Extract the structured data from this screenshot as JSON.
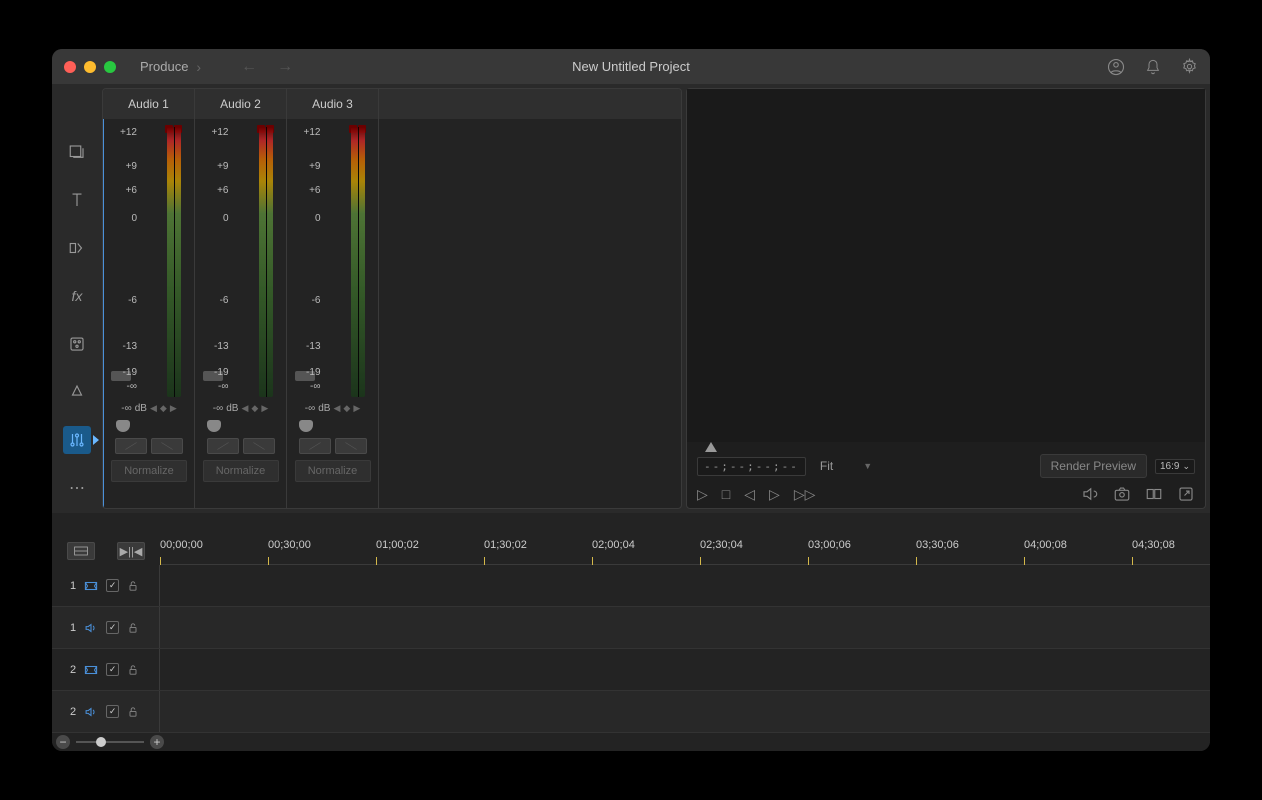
{
  "header": {
    "app": "Produce",
    "title": "New Untitled Project"
  },
  "mixer": {
    "channels": [
      {
        "name": "Audio 1",
        "db": "dB",
        "ninf_l": "-∞",
        "ninf_r": "-∞",
        "normalize": "Normalize"
      },
      {
        "name": "Audio 2",
        "db": "dB",
        "ninf_l": "-∞",
        "ninf_r": "-∞",
        "normalize": "Normalize"
      },
      {
        "name": "Audio 3",
        "db": "dB",
        "ninf_l": "-∞",
        "ninf_r": "-∞",
        "normalize": "Normalize"
      }
    ],
    "scale": [
      "+12",
      "+9",
      "+6",
      "0",
      "-6",
      "-13",
      "-19"
    ]
  },
  "preview": {
    "timecode": "--;--;--;--",
    "fit": "Fit",
    "render": "Render Preview",
    "aspect": "16:9"
  },
  "timeline": {
    "marks": [
      "00;00;00",
      "00;30;00",
      "01;00;02",
      "01;30;02",
      "02;00;04",
      "02;30;04",
      "03;00;06",
      "03;30;06",
      "04;00;08",
      "04;30;08"
    ],
    "tracks": [
      {
        "num": "1",
        "type": "video"
      },
      {
        "num": "1",
        "type": "audio"
      },
      {
        "num": "2",
        "type": "video"
      },
      {
        "num": "2",
        "type": "audio"
      }
    ]
  },
  "zoom": {
    "minus": "−",
    "plus": "+"
  }
}
